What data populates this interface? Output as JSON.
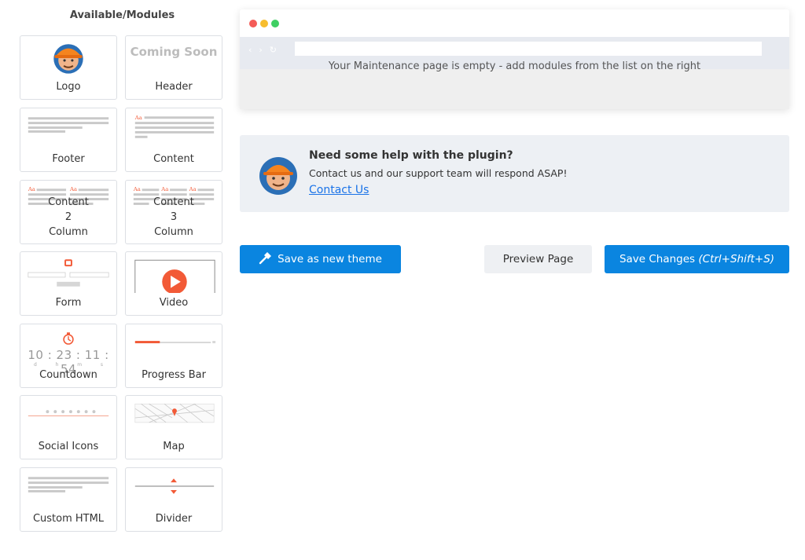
{
  "sidebar": {
    "title": "Available/Modules",
    "modules": [
      {
        "label": "Logo"
      },
      {
        "label": "Header",
        "thumb_text": "Coming Soon"
      },
      {
        "label": "Footer"
      },
      {
        "label": "Content"
      },
      {
        "label": "Content 2 Column"
      },
      {
        "label": "Content 3 Column"
      },
      {
        "label": "Form"
      },
      {
        "label": "Video"
      },
      {
        "label": "Countdown",
        "digits": "10 : 23 : 11 : 54",
        "units": [
          "d",
          "h",
          "m",
          "s"
        ]
      },
      {
        "label": "Progress Bar"
      },
      {
        "label": "Social Icons"
      },
      {
        "label": "Map"
      },
      {
        "label": "Custom HTML"
      },
      {
        "label": "Divider"
      }
    ]
  },
  "preview": {
    "empty_message": "Your Maintenance page is empty - add modules from the list on the right",
    "window_dot_colors": [
      "#f45b57",
      "#f7bd2e",
      "#3fcf63"
    ]
  },
  "help": {
    "title": "Need some help with the plugin?",
    "text": "Contact us and our support team will respond ASAP!",
    "link_label": "Contact Us"
  },
  "actions": {
    "save_theme_label": "Save as new theme",
    "preview_label": "Preview Page",
    "save_changes_label": "Save Changes ",
    "save_changes_shortcut": "(Ctrl+Shift+S)"
  },
  "colors": {
    "accent": "#0a85e0",
    "link": "#1a73e8",
    "module_red": "#f25a37"
  }
}
